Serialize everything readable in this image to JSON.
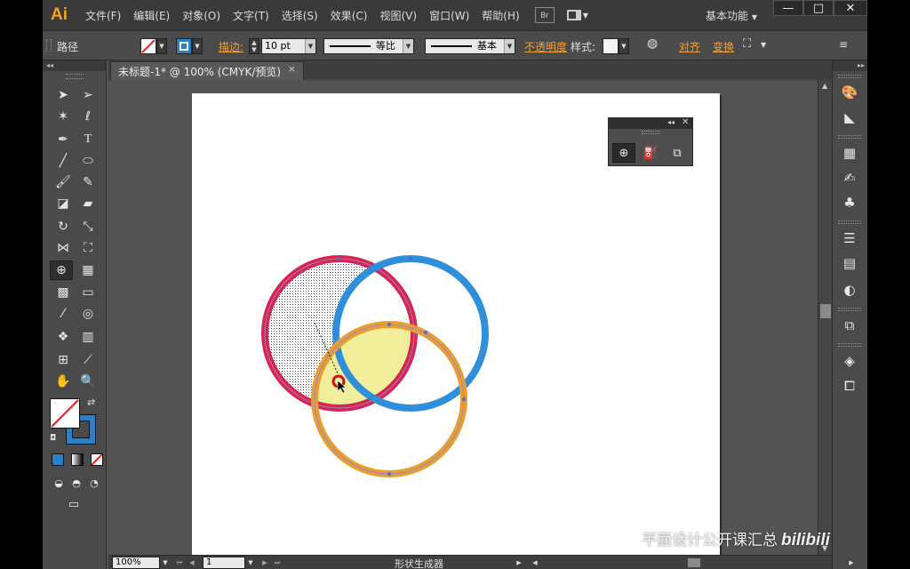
{
  "app": {
    "logo": "Ai",
    "menus": [
      "文件(F)",
      "编辑(E)",
      "对象(O)",
      "文字(T)",
      "选择(S)",
      "效果(C)",
      "视图(V)",
      "窗口(W)",
      "帮助(H)"
    ],
    "bridge_label": "Br",
    "workspace": "基本功能"
  },
  "window_controls": {
    "minimize": "—",
    "maximize": "□",
    "close": "✕"
  },
  "control_bar": {
    "selection_type": "路径",
    "stroke_label": "描边:",
    "stroke_weight": "10 pt",
    "profile_uniform": "等比",
    "brush_basic": "基本",
    "opacity_label": "不透明度",
    "style_label": "样式:",
    "align_label": "对齐",
    "transform_label": "变换"
  },
  "document": {
    "tab_title": "未标题-1* @ 100% (CMYK/预览)",
    "close": "×"
  },
  "status_bar": {
    "zoom": "100%",
    "artboard_number": "1",
    "current_tool": "形状生成器"
  },
  "artwork": {
    "circles": [
      {
        "name": "red-circle",
        "color": "#d8244f"
      },
      {
        "name": "blue-circle",
        "color": "#2f8fdb"
      },
      {
        "name": "orange-circle",
        "color": "#eb9d2e"
      }
    ],
    "highlight_fill": "#f2ef9c",
    "cursor_color": "#cc1111"
  },
  "watermark": {
    "text": "平面设计公开课汇总",
    "brand": "bilibili"
  },
  "colors": {
    "menu_bg": "#3a3a3a",
    "panel_bg": "#4a4a4a",
    "canvas_bg": "#535353",
    "accent_orange": "#f0a13a",
    "fill_blue": "#2a7fc9"
  }
}
